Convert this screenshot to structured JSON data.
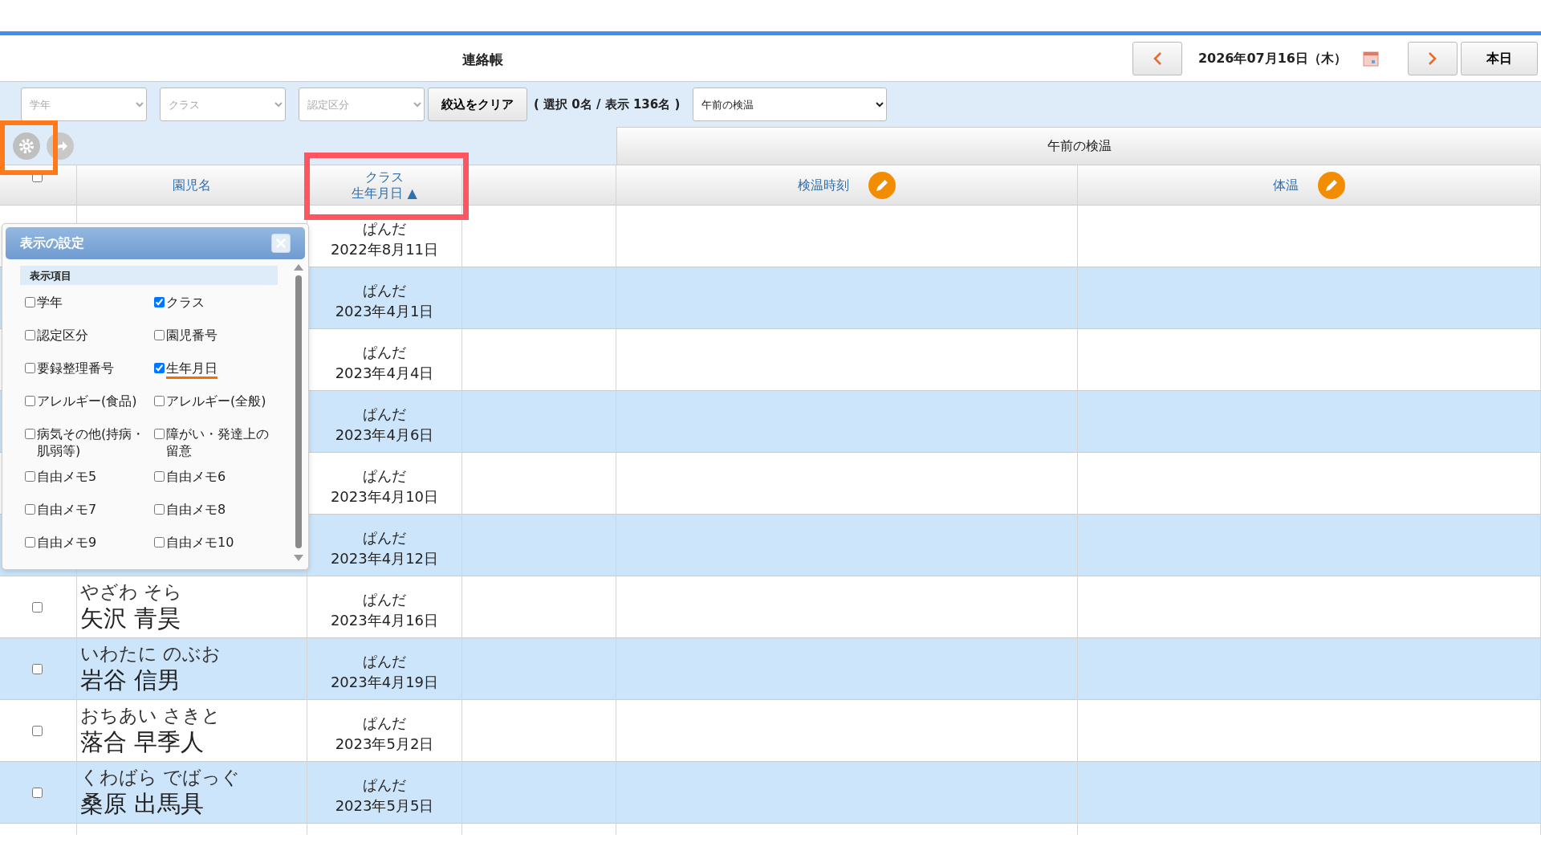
{
  "title": "連絡帳",
  "date_nav": {
    "date": "2026年07月16日（木）",
    "today_button": "本日"
  },
  "filters": [
    {
      "placeholder": "学年"
    },
    {
      "placeholder": "クラス"
    },
    {
      "placeholder": "認定区分"
    }
  ],
  "clear_button": "絞込をクリア",
  "count_text": "( 選択 0名 / 表示 136名 )",
  "view_select": {
    "value": "午前の検温"
  },
  "toolbar": {
    "settings_highlighted": true
  },
  "group_header": "午前の検温",
  "columns": [
    {
      "kind": "name",
      "label": "園児名"
    },
    {
      "kind": "sort",
      "lines": [
        "クラス",
        "生年月日"
      ],
      "sort_mark": "▲",
      "highlighted": true
    },
    {
      "kind": "blank"
    },
    {
      "kind": "edit",
      "label": "検温時刻"
    },
    {
      "kind": "edit",
      "label": "体温"
    }
  ],
  "select_all_checked": false,
  "rows": [
    {
      "class": "ぱんだ",
      "birthdate": "2022年8月11日"
    },
    {
      "class": "ぱんだ",
      "birthdate": "2023年4月1日"
    },
    {
      "class": "ぱんだ",
      "birthdate": "2023年4月4日"
    },
    {
      "class": "ぱんだ",
      "birthdate": "2023年4月6日"
    },
    {
      "class": "ぱんだ",
      "birthdate": "2023年4月10日"
    },
    {
      "class": "ぱんだ",
      "birthdate": "2023年4月12日"
    },
    {
      "kana": "やざわ そら",
      "name": "矢沢 青昊",
      "class": "ぱんだ",
      "birthdate": "2023年4月16日",
      "checked": false
    },
    {
      "kana": "いわたに のぶお",
      "name": "岩谷 信男",
      "class": "ぱんだ",
      "birthdate": "2023年4月19日",
      "checked": false
    },
    {
      "kana": "おちあい さきと",
      "name": "落合 早季人",
      "class": "ぱんだ",
      "birthdate": "2023年5月2日",
      "checked": false
    },
    {
      "kana": "くわばら でばっぐ",
      "name": "桑原 出馬具",
      "class": "ぱんだ",
      "birthdate": "2023年5月5日",
      "checked": false
    }
  ],
  "settings_dialog": {
    "title": "表示の設定",
    "section": "表示項目",
    "items": [
      {
        "label": "学年",
        "checked": false,
        "highlighted": false
      },
      {
        "label": "クラス",
        "checked": true,
        "highlighted": false
      },
      {
        "label": "認定区分",
        "checked": false,
        "highlighted": false
      },
      {
        "label": "園児番号",
        "checked": false,
        "highlighted": false
      },
      {
        "label": "要録整理番号",
        "checked": false,
        "highlighted": false
      },
      {
        "label": "生年月日",
        "checked": true,
        "highlighted": true
      },
      {
        "label": "アレルギー(食品)",
        "checked": false,
        "highlighted": false
      },
      {
        "label": "アレルギー(全般)",
        "checked": false,
        "highlighted": false
      },
      {
        "label": "病気その他(持病・肌弱等)",
        "checked": false,
        "highlighted": false
      },
      {
        "label": "障がい・発達上の留意",
        "checked": false,
        "highlighted": false
      },
      {
        "label": "自由メモ5",
        "checked": false,
        "highlighted": false
      },
      {
        "label": "自由メモ6",
        "checked": false,
        "highlighted": false
      },
      {
        "label": "自由メモ7",
        "checked": false,
        "highlighted": false
      },
      {
        "label": "自由メモ8",
        "checked": false,
        "highlighted": false
      },
      {
        "label": "自由メモ9",
        "checked": false,
        "highlighted": false
      },
      {
        "label": "自由メモ10",
        "checked": false,
        "highlighted": false
      }
    ]
  }
}
